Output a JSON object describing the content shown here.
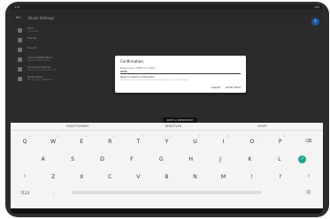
{
  "status": {
    "time": "9:41",
    "battery": "100"
  },
  "appbar": {
    "title": "Quick Settings",
    "back_icon": "arrow-left-icon"
  },
  "fabs": [
    {
      "icon": "plus-icon"
    },
    {
      "icon": "gear-icon"
    }
  ],
  "list": [
    {
      "title": "Wi-Fi",
      "subtitle": "Connected"
    },
    {
      "title": "Display",
      "subtitle": ""
    },
    {
      "title": "Sounds",
      "subtitle": ""
    },
    {
      "title": "Apps & Notifications",
      "subtitle": "Recent & default apps"
    },
    {
      "title": "Connected devices",
      "subtitle": "Bluetooth, Android Auto, NFC"
    },
    {
      "title": "Notifications",
      "subtitle": "Manage app notifications"
    }
  ],
  "dialog": {
    "title": "Confirmation",
    "label": "Please type in 'RESET' to confirm",
    "value": "RESE",
    "sub": "Reset to default configuration",
    "hint": "This action will reset all your preferences and settings to their default values",
    "cancel": "CANCEL",
    "ok": "RESET NOW"
  },
  "toast": "RESET & CONFIRM RESET",
  "keyboard": {
    "suggestions": [
      "RESETTLEMENT",
      "RESETTLED",
      "RESET"
    ],
    "row1": [
      {
        "k": "Q",
        "n": "1"
      },
      {
        "k": "W",
        "n": "2"
      },
      {
        "k": "E",
        "n": "3"
      },
      {
        "k": "R",
        "n": "4"
      },
      {
        "k": "T",
        "n": "5"
      },
      {
        "k": "Y",
        "n": "6"
      },
      {
        "k": "U",
        "n": "7"
      },
      {
        "k": "I",
        "n": "8"
      },
      {
        "k": "O",
        "n": "9"
      },
      {
        "k": "P",
        "n": "0"
      }
    ],
    "row2": [
      "A",
      "S",
      "D",
      "F",
      "G",
      "H",
      "J",
      "K",
      "L"
    ],
    "row3": [
      "Z",
      "X",
      "C",
      "V",
      "B",
      "N",
      "M",
      "!",
      "?"
    ],
    "backspace_icon": "backspace-icon",
    "enter_icon": "check-icon",
    "shift_icon": "shift-icon",
    "numbers_key": "?123",
    "comma": ",",
    "period": ".",
    "emoji_icon": "emoji-icon"
  },
  "colors": {
    "accent": "#1ba58c",
    "fab": "#2d6fd6"
  }
}
